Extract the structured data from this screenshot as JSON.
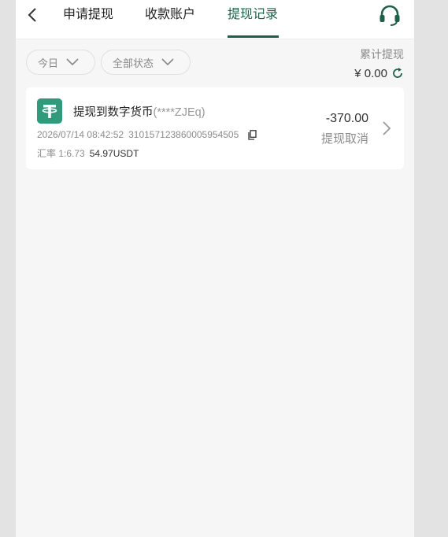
{
  "header": {
    "tabs": [
      {
        "label": "申请提现"
      },
      {
        "label": "收款账户"
      },
      {
        "label": "提现记录",
        "active": true
      }
    ],
    "back_icon": "chevron-left-icon",
    "support_icon": "headset-icon"
  },
  "filters": {
    "date": "今日",
    "status": "全部状态"
  },
  "summary": {
    "label": "累计提现",
    "value": "¥ 0.00"
  },
  "records": [
    {
      "title": "提现到数字货币",
      "masked_account": "(****ZJEq)",
      "datetime": "2026/07/14 08:42:52",
      "txid": "310157123860005954505",
      "rate_label": "汇率 1:6.73",
      "usdt": "54.97USDT",
      "amount": "-370.00",
      "status": "提现取消"
    }
  ],
  "colors": {
    "accent": "#1f5f4a",
    "coin": "#2f9b7a",
    "page_bg": "#f6f6f6"
  }
}
